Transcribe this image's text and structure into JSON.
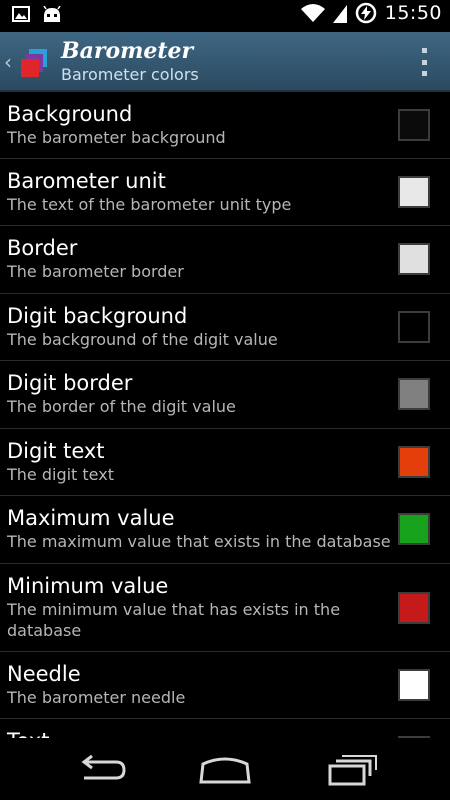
{
  "status_bar": {
    "time": "15:50",
    "icons": [
      "gallery-icon",
      "android-debug-icon",
      "wifi-icon",
      "signal-icon",
      "battery-charging-icon"
    ]
  },
  "action_bar": {
    "title": "Barometer",
    "subtitle": "Barometer colors",
    "icons": [
      "up-caret-icon",
      "app-icon",
      "overflow-menu-icon"
    ]
  },
  "preferences": [
    {
      "title": "Background",
      "summary": "The barometer background",
      "color": "#0b0b0b"
    },
    {
      "title": "Barometer unit",
      "summary": "The text of the barometer unit type",
      "color": "#e7e7e7"
    },
    {
      "title": "Border",
      "summary": "The barometer border",
      "color": "#e0e0e0"
    },
    {
      "title": "Digit background",
      "summary": "The background of the digit value",
      "color": "#000000"
    },
    {
      "title": "Digit border",
      "summary": "The border of the digit value",
      "color": "#808080"
    },
    {
      "title": "Digit text",
      "summary": "The digit text",
      "color": "#e43f0b"
    },
    {
      "title": "Maximum value",
      "summary": "The maximum value that exists in the database",
      "color": "#16a31b"
    },
    {
      "title": "Minimum value",
      "summary": "The minimum value that has exists in the database",
      "color": "#c41a1a"
    },
    {
      "title": "Needle",
      "summary": "The barometer needle",
      "color": "#ffffff"
    },
    {
      "title": "Text",
      "summary": "",
      "color": "#4a93b8"
    }
  ],
  "nav_bar": {
    "icons": [
      "back-icon",
      "home-icon",
      "recent-apps-icon"
    ]
  }
}
